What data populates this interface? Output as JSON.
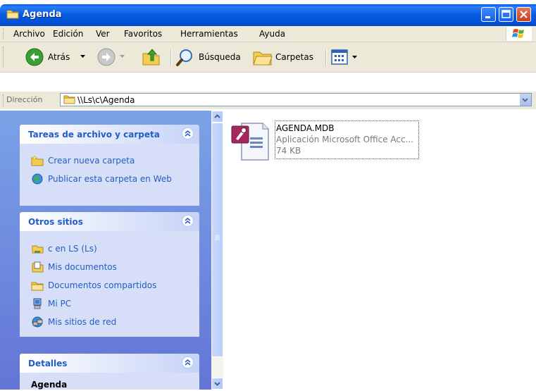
{
  "window": {
    "title": "Agenda"
  },
  "menu": {
    "items": [
      {
        "label": "Archivo"
      },
      {
        "label": "Edición"
      },
      {
        "label": "Ver"
      },
      {
        "label": "Favoritos"
      },
      {
        "label": "Herramientas"
      },
      {
        "label": "Ayuda"
      }
    ]
  },
  "toolbar": {
    "back_label": "Atrás",
    "search_label": "Búsqueda",
    "folders_label": "Carpetas"
  },
  "address": {
    "label": "Dirección",
    "value": "\\\\Ls\\c\\Agenda"
  },
  "left_panel": {
    "file_tasks": {
      "title": "Tareas de archivo y carpeta",
      "items": [
        {
          "label": "Crear nueva carpeta"
        },
        {
          "label": "Publicar esta carpeta en Web"
        }
      ]
    },
    "other_places": {
      "title": "Otros sitios",
      "items": [
        {
          "label": "c en LS (Ls)"
        },
        {
          "label": "Mis documentos"
        },
        {
          "label": "Documentos compartidos"
        },
        {
          "label": "Mi PC"
        },
        {
          "label": "Mis sitios de red"
        }
      ]
    },
    "details": {
      "title": "Detalles",
      "folder_name": "Agenda"
    }
  },
  "files": [
    {
      "name": "AGENDA.MDB",
      "type": "Aplicación Microsoft Office Acc...",
      "size": "74 KB"
    }
  ],
  "colors": {
    "titlebar": "#0559e0",
    "task_link": "#215dc6",
    "pane_background": "#7ba2e7"
  }
}
